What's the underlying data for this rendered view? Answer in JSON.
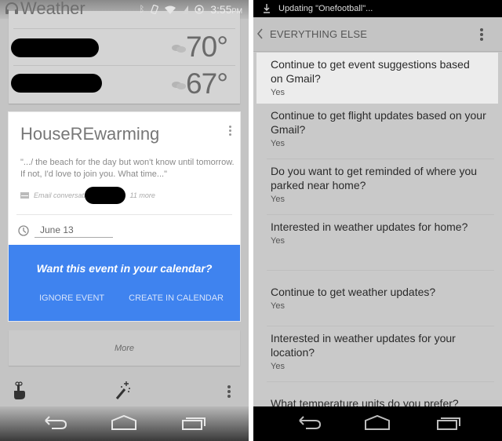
{
  "left_screen": {
    "status_bar": {
      "app_title": "Weather",
      "time": "3:55",
      "time_suffix": "PM",
      "icons": [
        "bluetooth-icon",
        "rotation-icon",
        "wifi-icon",
        "signal-icon",
        "data-saver-icon"
      ]
    },
    "weather": {
      "rows": [
        {
          "location": "[redacted]",
          "condition_icon": "cloudy-icon",
          "temperature": "70°"
        },
        {
          "location": "[redacted]",
          "condition_icon": "cloudy-icon",
          "temperature": "67°"
        }
      ]
    },
    "event_card": {
      "title": "HouseREwarming",
      "snippet": "\".../ the beach for the day but won't know until tomorrow. If not, I'd love to join you. What time...\"",
      "email_label": "Email conversation with",
      "email_more": "11 more",
      "date": "June 13",
      "prompt": {
        "question": "Want this event in your calendar?",
        "ignore_label": "IGNORE EVENT",
        "create_label": "CREATE IN CALENDAR",
        "color": "#3f83ef"
      }
    },
    "more_label": "More",
    "bottom_actions": [
      "remind-icon",
      "magic-wand-icon",
      "overflow-menu-icon"
    ]
  },
  "right_screen": {
    "status_bar": {
      "notification": "Updating \"Onefootball\"..."
    },
    "action_bar": {
      "title": "EVERYTHING ELSE"
    },
    "settings": [
      {
        "question": "Continue to get event suggestions based on Gmail?",
        "answer": "Yes"
      },
      {
        "question": "Continue to get flight updates based on your Gmail?",
        "answer": "Yes"
      },
      {
        "question": "Do you want to get reminded of where you parked near home?",
        "answer": "Yes"
      },
      {
        "question": "Interested in weather updates for home?",
        "answer": "Yes"
      },
      {
        "question": "Continue to get weather updates?",
        "answer": "Yes"
      },
      {
        "question": "Interested in weather updates for your location?",
        "answer": "Yes"
      },
      {
        "question": "What temperature units do you prefer?",
        "answer": ""
      }
    ]
  }
}
